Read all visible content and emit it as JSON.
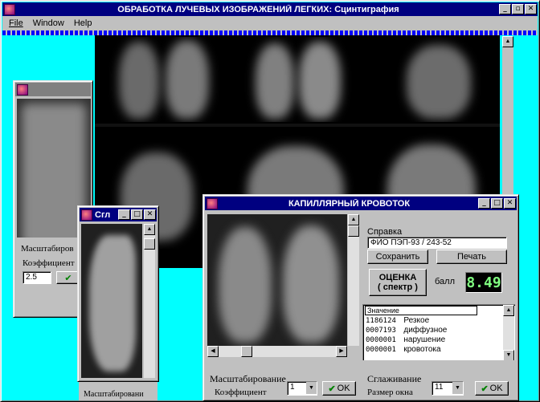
{
  "main_window": {
    "title": "ОБРАБОТКА ЛУЧЕВЫХ ИЗОБРАЖЕНИЙ ЛЕГКИХ: Сцинтиграфия",
    "menu": [
      "File",
      "Window",
      "Help"
    ],
    "controls": [
      "_",
      "▫",
      "✕"
    ]
  },
  "left_window": {
    "scale_label": "Масштабиров",
    "coef_label": "Коэффициент",
    "coef_value": "2.5"
  },
  "smooth_window": {
    "title": "Сгл",
    "controls": [
      "_",
      "□",
      "✕"
    ],
    "bottom_label": "Масштабировани"
  },
  "capillary_window": {
    "title": "КАПИЛЛЯРНЫЙ КРОВОТОК",
    "controls": [
      "_",
      "□",
      "✕"
    ],
    "reference_label": "Справка",
    "reference_value": "ФИО ПЭП-93 / 243-52",
    "save_button": "Сохранить",
    "print_button": "Печать",
    "evaluate_button_line1": "ОЦЕНКА",
    "evaluate_button_line2": "( спектр )",
    "score_label": "балл",
    "score_value": "8.49",
    "list_header": "Значение",
    "list_rows": [
      {
        "code": "1186124",
        "text": "Резкое"
      },
      {
        "code": "0007193",
        "text": "диффузное"
      },
      {
        "code": "0000001",
        "text": "нарушение"
      },
      {
        "code": "0000001",
        "text": "кровотока"
      }
    ],
    "scale_label": "Масштабирование",
    "coef_label": "Коэффициент",
    "coef_value": "1",
    "ok_label": "OK",
    "smooth_label": "Сглаживание",
    "window_size_label": "Размер окна",
    "window_size_value": "11",
    "ok2_label": "OK"
  },
  "colors": {
    "desktop": "#00ffff",
    "titlebar_active": "#000080",
    "titlebar_inactive": "#808080",
    "window_face": "#c0c0c0",
    "score_text": "#80ff80"
  }
}
